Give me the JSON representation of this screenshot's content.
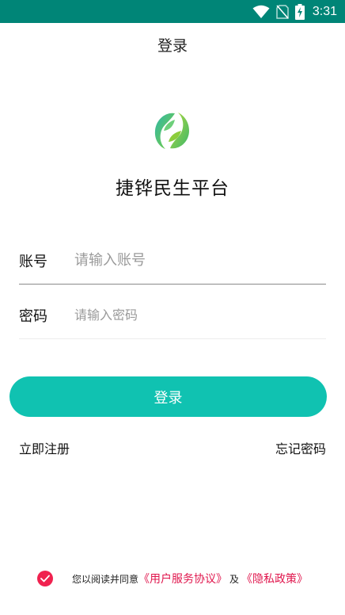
{
  "status_bar": {
    "time": "3:31",
    "icons": [
      "wifi-icon",
      "no-sim-icon",
      "battery-charging-icon"
    ],
    "background": "#008577"
  },
  "header": {
    "title": "登录"
  },
  "brand": {
    "app_name": "捷铧民生平台",
    "logo_icon": "leaf-logo-icon"
  },
  "form": {
    "account_label": "账号",
    "account_placeholder": "请输入账号",
    "account_value": "",
    "password_label": "密码",
    "password_placeholder": "请输入密码",
    "password_value": ""
  },
  "actions": {
    "login_label": "登录",
    "register_label": "立即注册",
    "forgot_label": "忘记密码"
  },
  "agreement": {
    "checked": true,
    "prefix": "您以阅读并同意",
    "user_agreement": "《用户服务协议》",
    "conjunction": "及",
    "privacy_policy": "《隐私政策》"
  },
  "colors": {
    "accent": "#10c2b1",
    "link_red": "#e0164d",
    "check_red": "#f0224f"
  }
}
